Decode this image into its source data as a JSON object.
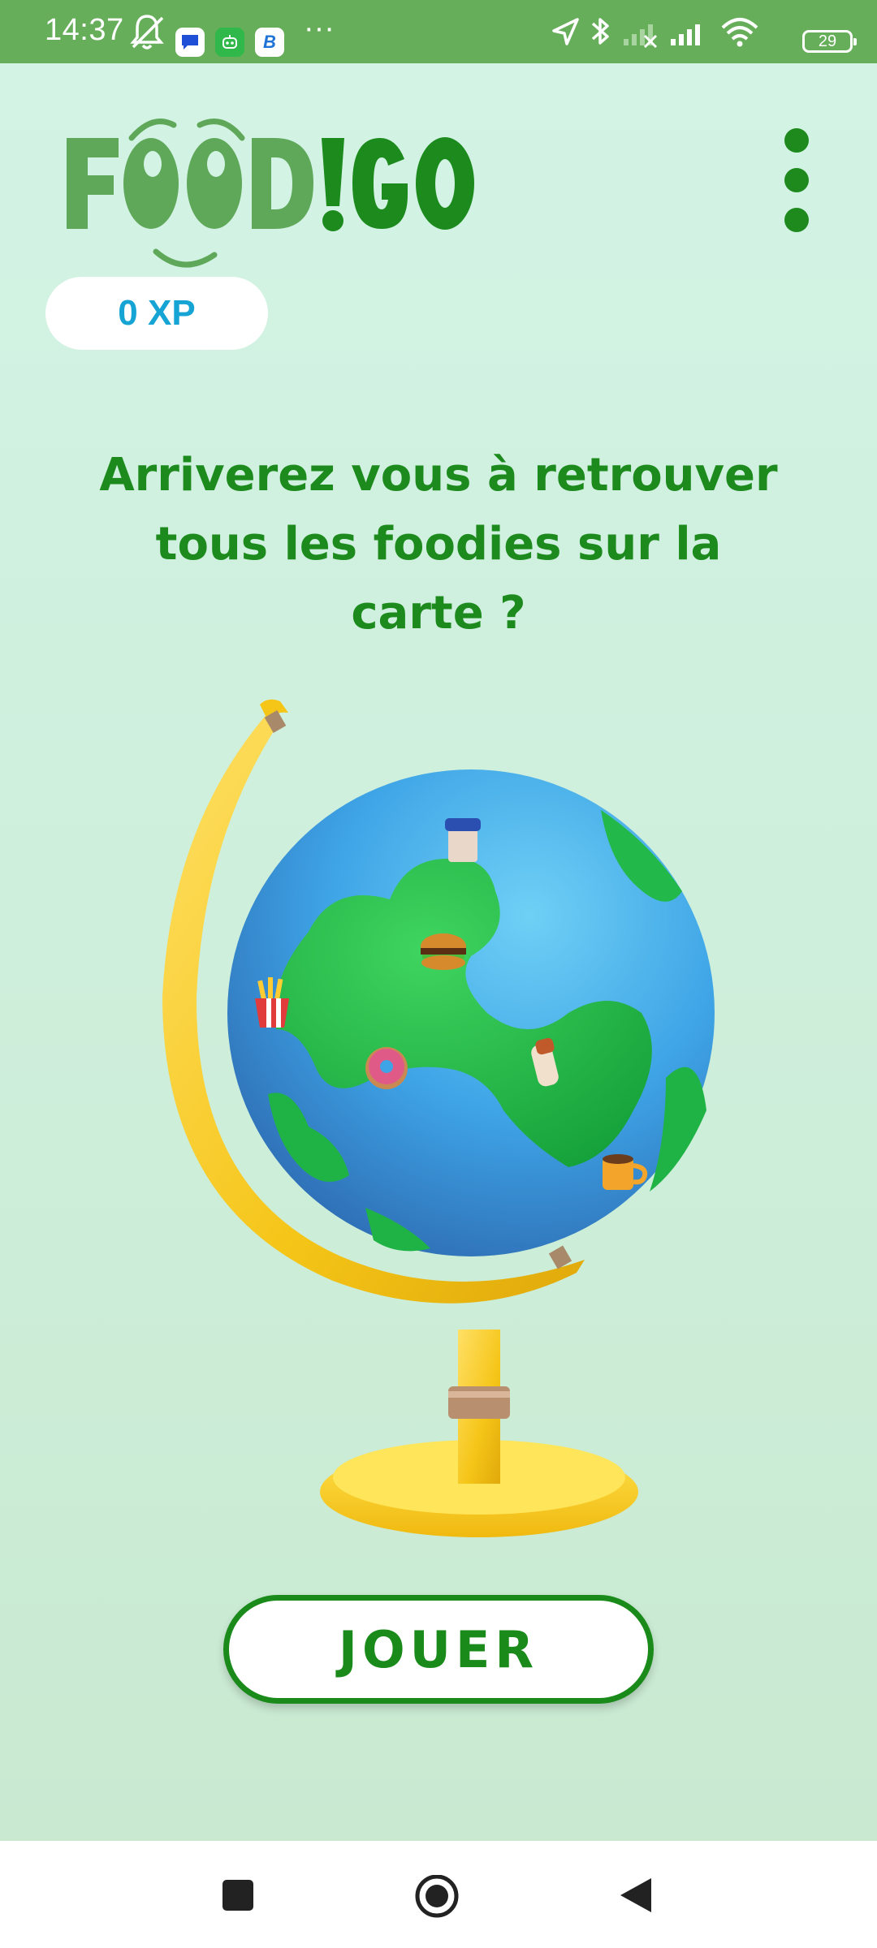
{
  "status_bar": {
    "time": "14:37",
    "more_indicator": "···",
    "battery_level": "29",
    "icons": [
      "mute-bell-icon",
      "chat-app-icon",
      "robot-app-icon",
      "b-app-icon",
      "location-arrow-icon",
      "bluetooth-icon",
      "cellular-signal-icon",
      "cellular-signal-icon",
      "wifi-icon",
      "battery-icon"
    ]
  },
  "header": {
    "logo_text": "FOOD!GO",
    "xp_label": "0 XP",
    "menu_icon": "more-vertical-icon"
  },
  "main": {
    "headline": "Arriverez vous à retrouver tous les foodies sur la carte ?",
    "illustration": "globe-with-food-icons",
    "play_button_label": "JOUER"
  },
  "nav_bar": {
    "buttons": [
      "recent-apps-icon",
      "home-icon",
      "back-icon"
    ]
  },
  "colors": {
    "status_bar": "#67ae5b",
    "brand_green": "#1c8a1c",
    "logo_light_green": "#5fa85a",
    "xp_blue": "#16a4d4",
    "background": "#d3f3e5"
  }
}
